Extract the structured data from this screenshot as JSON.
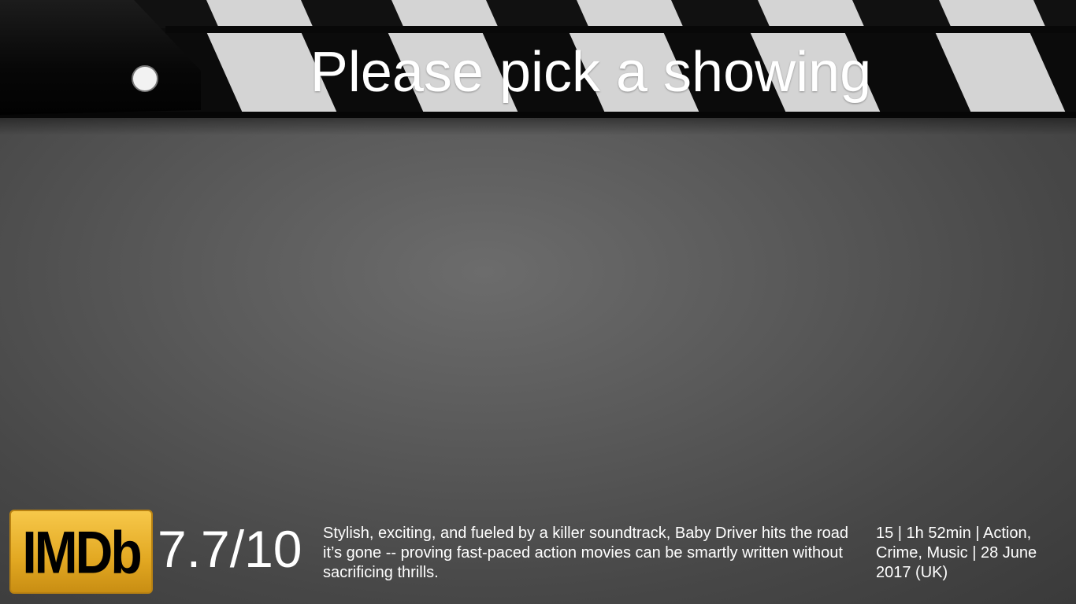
{
  "header": {
    "title": "Please pick a showing"
  },
  "movie": {
    "imdb_logo_text": "IMDb",
    "rating": "7.7/10",
    "summary": "Stylish, exciting, and fueled by a killer soundtrack, Baby Driver hits the road it’s gone -- proving fast-paced action movies can be smartly written without sacrificing thrills.",
    "details": "15 | 1h 52min | Action, Crime, Music | 28 June 2017 (UK)"
  },
  "colors": {
    "background": "#5a5a5a",
    "clapper_black": "#0c0c0c",
    "clapper_stripe": "#d4d4d4",
    "imdb_gold": "#e2a822"
  }
}
